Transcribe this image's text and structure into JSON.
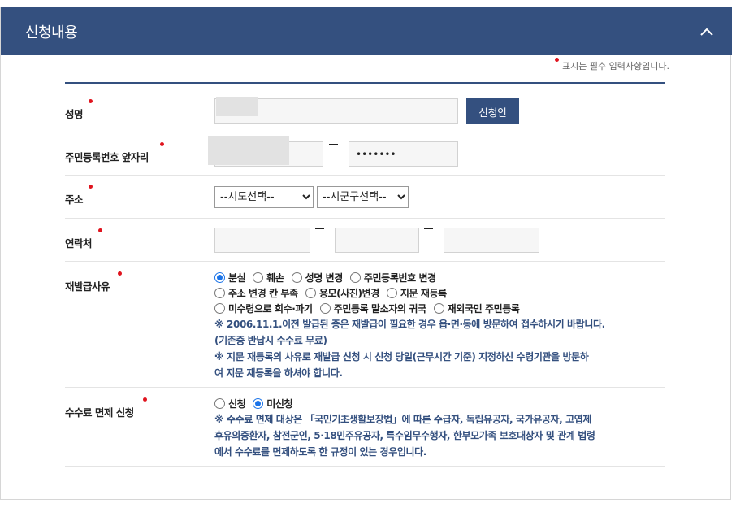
{
  "header": {
    "title": "신청내용"
  },
  "required_note": "표시는 필수 입력사항입니다.",
  "name_row": {
    "label": "성명",
    "button": "신청인"
  },
  "rrn_row": {
    "label": "주민등록번호 앞자리",
    "back_value": "•••••••"
  },
  "address_row": {
    "label": "주소",
    "sido_selected": "--시도선택--",
    "sigungu_selected": "--시군구선택--"
  },
  "contact_row": {
    "label": "연락처"
  },
  "reason_row": {
    "label": "재발급사유",
    "options_line1": [
      "분실",
      "훼손",
      "성명 변경",
      "주민등록번호 변경"
    ],
    "options_line2": [
      "주소 변경 칸 부족",
      "용모(사진)변경",
      "지문 재등록"
    ],
    "options_line3": [
      "미수령으로 회수·파기",
      "주민등록 말소자의 귀국",
      "재외국민 주민등록"
    ],
    "selected": "분실",
    "note1a": "※ 2006.11.1.이전 발급된 증은 재발급이 필요한 경우 읍·면·동에 방문하여 접수하시기 바랍니다.",
    "note1b": "(기존증 반납시 수수료 무료)",
    "note2a": "※ 지문 재등록의 사유로 재발급 신청 시 신청 당일(근무시간 기준) 지정하신 수령기관을 방문하",
    "note2b": "여 지문 재등록을 하셔야 합니다."
  },
  "fee_row": {
    "label": "수수료 면제 신청",
    "opt_apply": "신청",
    "opt_notapply": "미신청",
    "selected": "미신청",
    "note_a": "※ 수수료 면제 대상은 「국민기초생활보장법」에 따른 수급자, 독립유공자, 국가유공자, 고엽제",
    "note_b": "후유의증환자, 참전군인, 5·18민주유공자, 특수임무수행자, 한부모가족 보호대상자 및 관계 법령",
    "note_c": "에서 수수료를 면제하도록 한 규정이 있는 경우입니다."
  },
  "colors": {
    "primary": "#34507f",
    "required": "#e0141e",
    "radio_selected": "#1a73e8"
  }
}
